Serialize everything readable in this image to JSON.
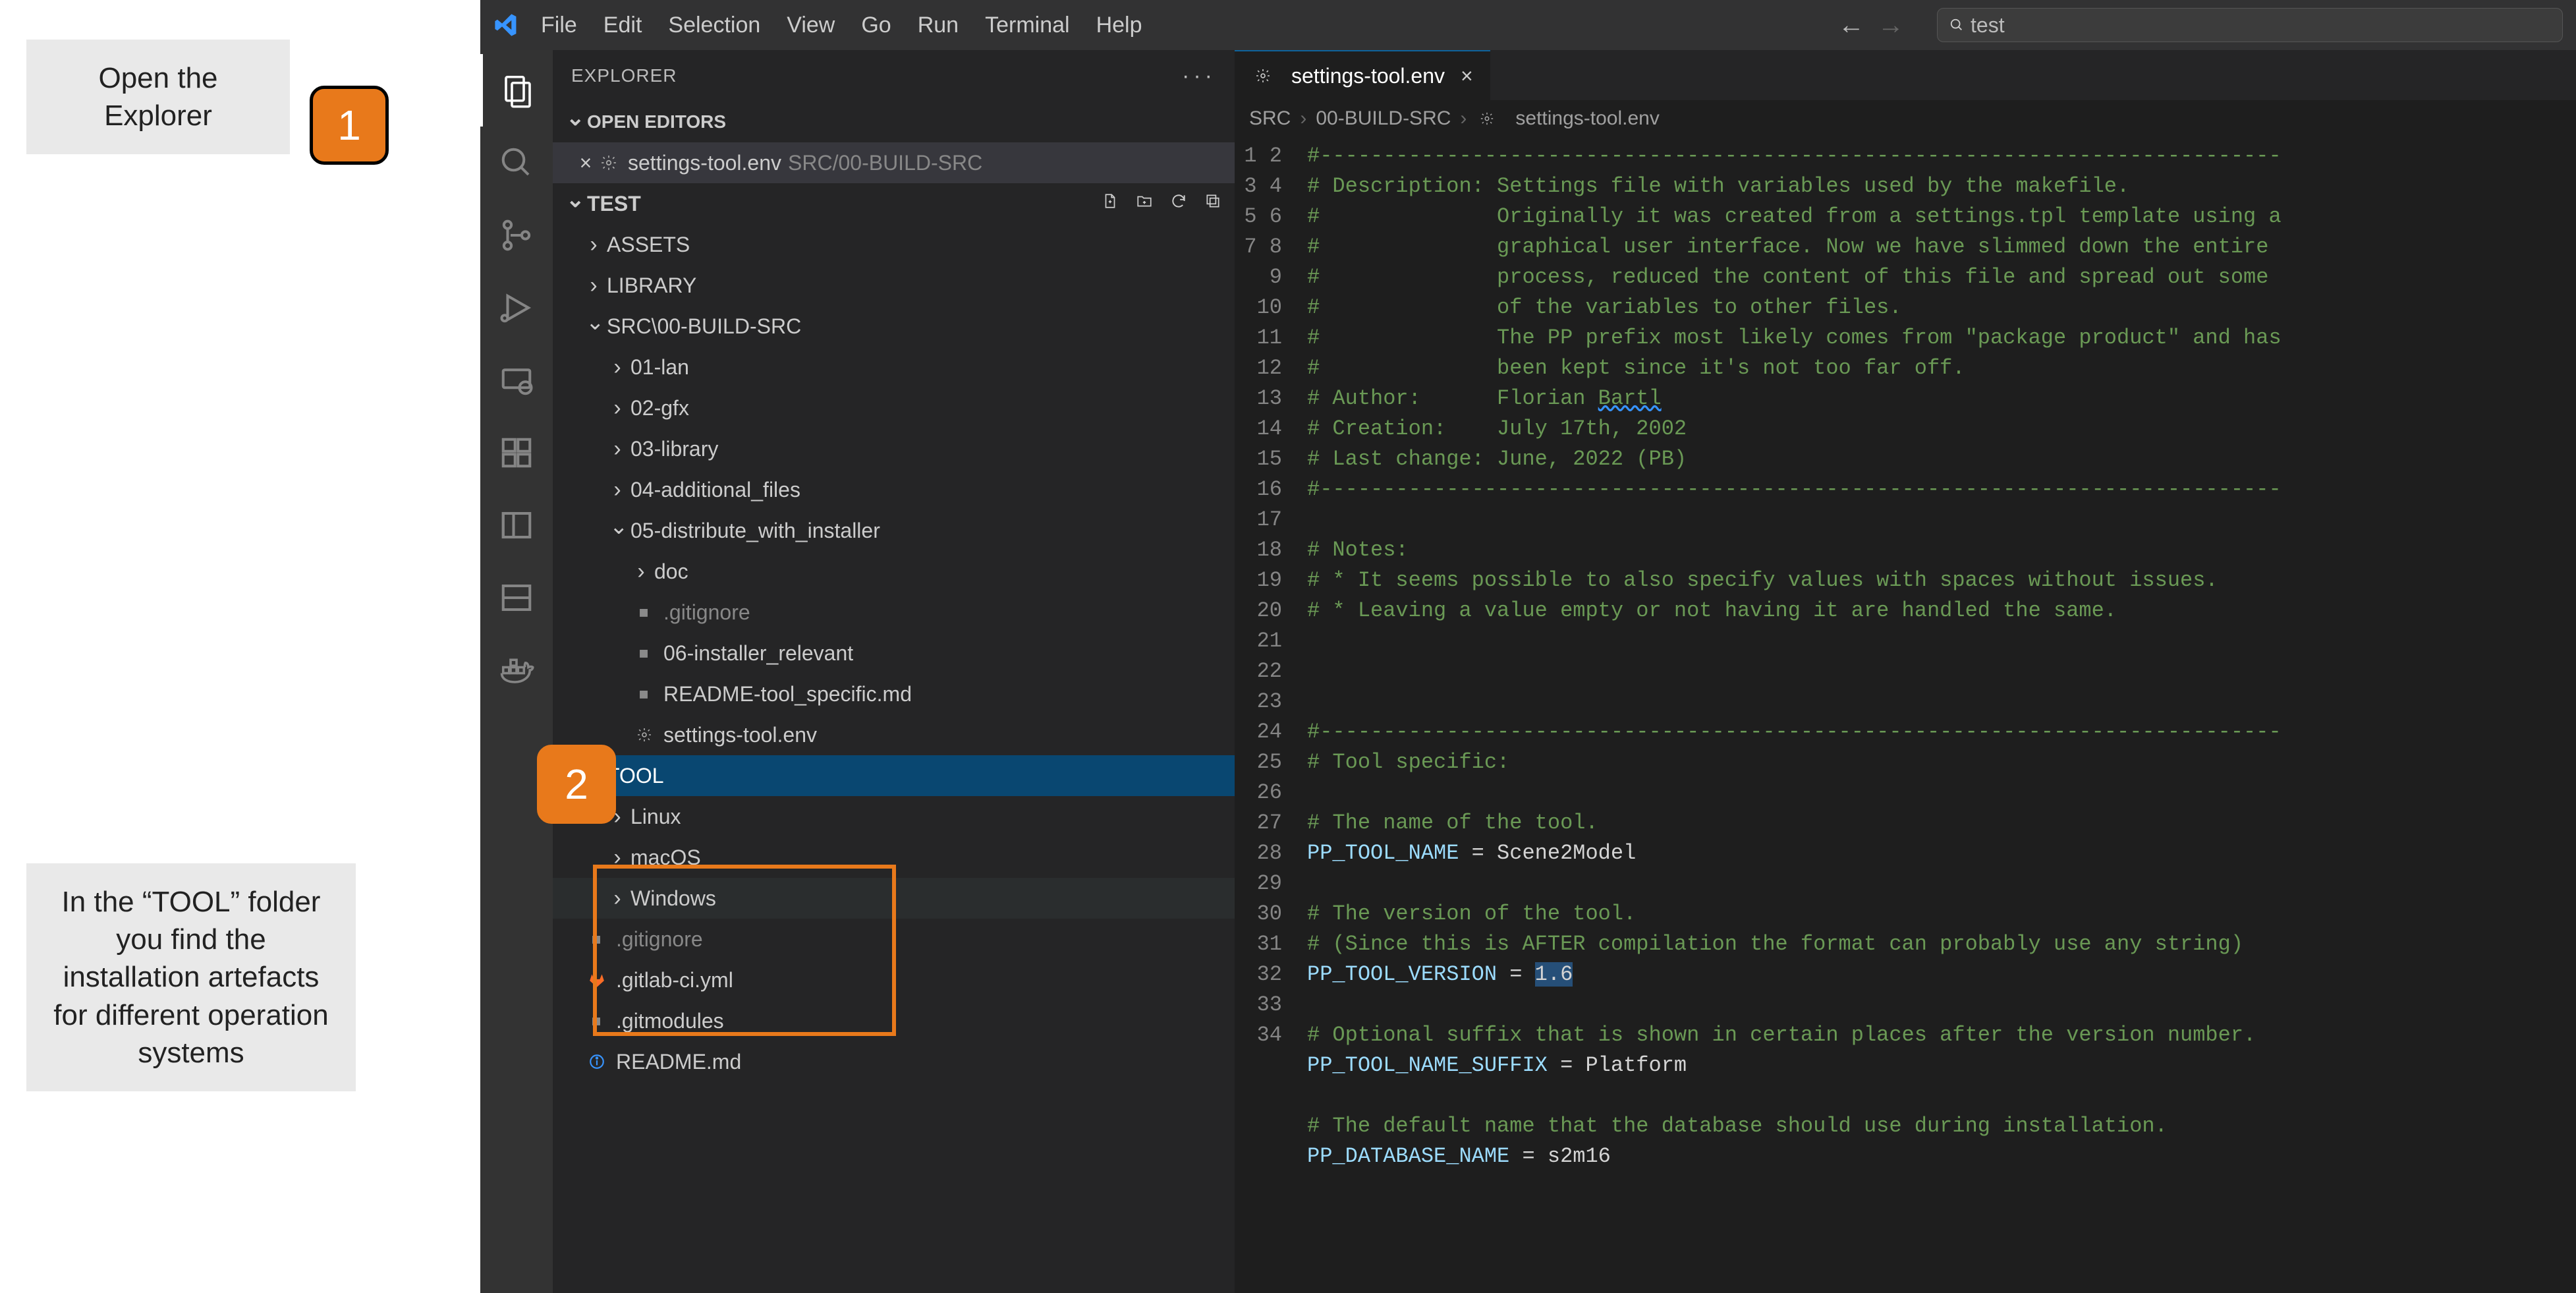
{
  "annotations": {
    "a1": "Open the Explorer",
    "a2": "In the “TOOL” folder you find the installation artefacts for different operation systems",
    "badge1": "1",
    "badge2": "2"
  },
  "menubar": {
    "items": [
      "File",
      "Edit",
      "Selection",
      "View",
      "Go",
      "Run",
      "Terminal",
      "Help"
    ],
    "search_value": "test"
  },
  "activitybar": {
    "items": [
      {
        "name": "explorer",
        "active": true
      },
      {
        "name": "search"
      },
      {
        "name": "source-control"
      },
      {
        "name": "run-debug"
      },
      {
        "name": "remote"
      },
      {
        "name": "extensions"
      },
      {
        "name": "panel-a"
      },
      {
        "name": "panel-b"
      },
      {
        "name": "docker"
      }
    ]
  },
  "sidebar": {
    "title": "EXPLORER",
    "open_editors_label": "OPEN EDITORS",
    "open_editor": {
      "file": "settings-tool.env",
      "path": "SRC/00-BUILD-SRC"
    },
    "root_label": "TEST",
    "tree": {
      "assets": "ASSETS",
      "library": "LIBRARY",
      "src_build": "SRC\\00-BUILD-SRC",
      "f01": "01-lan",
      "f02": "02-gfx",
      "f03": "03-library",
      "f04": "04-additional_files",
      "f05": "05-distribute_with_installer",
      "doc": "doc",
      "gitignore1": ".gitignore",
      "f06": "06-installer_relevant",
      "readme_tool": "README-tool_specific.md",
      "settings_env": "settings-tool.env",
      "tool": "TOOL",
      "linux": "Linux",
      "macos": "macOS",
      "windows": "Windows",
      "gitignore2": ".gitignore",
      "gitlabci": ".gitlab-ci.yml",
      "gitmodules": ".gitmodules",
      "readme": "README.md"
    }
  },
  "editor": {
    "tab_label": "settings-tool.env",
    "breadcrumbs": [
      "SRC",
      "00-BUILD-SRC",
      "settings-tool.env"
    ],
    "code_lines": [
      "#----------------------------------------------------------------------------",
      "# Description: Settings file with variables used by the makefile.",
      "#              Originally it was created from a settings.tpl template using a",
      "#              graphical user interface. Now we have slimmed down the entire",
      "#              process, reduced the content of this file and spread out some",
      "#              of the variables to other files.",
      "#              The PP prefix most likely comes from \"package product\" and has",
      "#              been kept since it's not too far off.",
      {
        "raw": "# Author:      Florian <span class='underline-wave'>Bartl</span>"
      },
      "# Creation:    July 17th, 2002",
      "# Last change: June, 2022 (PB)",
      "#----------------------------------------------------------------------------",
      "",
      "# Notes:",
      "# * It seems possible to also specify values with spaces without issues.",
      "# * Leaving a value empty or not having it are handled the same.",
      "",
      "",
      "",
      "#----------------------------------------------------------------------------",
      "# Tool specific:",
      "",
      "# The name of the tool.",
      {
        "raw": "<span class='kw'>PP_TOOL_NAME</span> <span class='eq'>=</span> <span class='plain'>Scene2Model</span>"
      },
      "",
      "# The version of the tool.",
      "# (Since this is AFTER compilation the format can probably use any string)",
      {
        "raw": "<span class='kw'>PP_TOOL_VERSION</span> <span class='eq'>=</span> <span class='plain sel-bg'>1.6</span>"
      },
      "",
      "# Optional suffix that is shown in certain places after the version number.",
      {
        "raw": "<span class='kw'>PP_TOOL_NAME_SUFFIX</span> <span class='eq'>=</span> <span class='plain'>Platform</span>"
      },
      "",
      "# The default name that the database should use during installation.",
      {
        "raw": "<span class='kw'>PP_DATABASE_NAME</span> <span class='eq'>=</span> <span class='plain'>s2m16</span>"
      }
    ]
  }
}
